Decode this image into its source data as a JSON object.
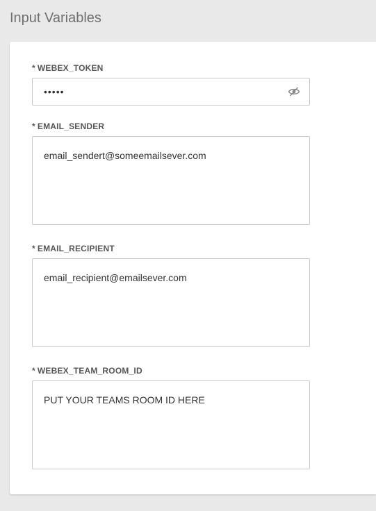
{
  "page": {
    "title": "Input Variables"
  },
  "fields": [
    {
      "required_mark": "*",
      "label": "WEBEX_TOKEN",
      "type": "password",
      "masked_value": "•••••",
      "toggle_icon": "eye-slash-icon"
    },
    {
      "required_mark": "*",
      "label": "EMAIL_SENDER",
      "type": "textarea",
      "value": "email_sendert@someemailsever.com"
    },
    {
      "required_mark": "*",
      "label": "EMAIL_RECIPIENT",
      "type": "textarea",
      "value": "email_recipient@emailsever.com"
    },
    {
      "required_mark": "*",
      "label": "WEBEX_TEAM_ROOM_ID",
      "type": "textarea",
      "value": "PUT YOUR TEAMS ROOM ID HERE"
    }
  ],
  "colors": {
    "background": "#e9e9e9",
    "card": "#ffffff",
    "border": "#c8c8c8",
    "title": "#707070",
    "label": "#555555"
  }
}
